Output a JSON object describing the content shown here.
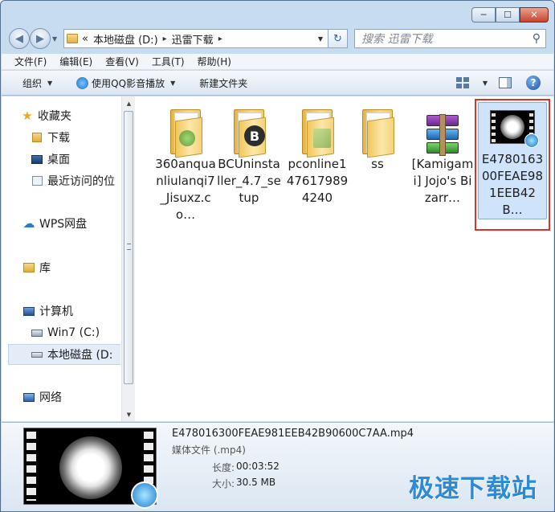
{
  "window": {
    "controls": {
      "minimize": "─",
      "maximize": "☐",
      "close": "✕"
    }
  },
  "address": {
    "chevrons": "«",
    "segments": [
      "本地磁盘 (D:)",
      "迅雷下载"
    ],
    "separator": "▸"
  },
  "search": {
    "placeholder": "搜索 迅雷下载"
  },
  "menu": [
    "文件(F)",
    "编辑(E)",
    "查看(V)",
    "工具(T)",
    "帮助(H)"
  ],
  "toolbar": {
    "organize": "组织",
    "play_qq": "使用QQ影音播放",
    "new_folder": "新建文件夹"
  },
  "nav": {
    "favorites": "收藏夹",
    "downloads": "下载",
    "desktop": "桌面",
    "recent": "最近访问的位",
    "wps": "WPS网盘",
    "libraries": "库",
    "computer": "计算机",
    "drive_c": "Win7 (C:)",
    "drive_d": "本地磁盘 (D:",
    "network": "网络"
  },
  "files": [
    {
      "name": "360anquanliulanqi7_Jisuxz.co…",
      "icon": "folder-icon"
    },
    {
      "name": "BCUninstaller_4.7_setup",
      "icon": "folder-icon"
    },
    {
      "name": "pconline1476179894240",
      "icon": "folder-icon"
    },
    {
      "name": "ss",
      "icon": "folder-icon"
    },
    {
      "name": "[Kamigami] Jojo's Bizarr…",
      "icon": "winrar-icon"
    },
    {
      "name": "E478016300FEAE981EEB42B…",
      "icon": "video-icon"
    }
  ],
  "details": {
    "filename": "E478016300FEAE981EEB42B90600C7AA.mp4",
    "type": "媒体文件 (.mp4)",
    "duration_label": "长度:",
    "duration": "00:03:52",
    "size_label": "大小:",
    "size": "30.5 MB"
  },
  "watermark": "极速下载站",
  "colors": {
    "accent": "#2d8bd6",
    "highlight": "#d9322b",
    "selection": "#cfe3fb"
  }
}
